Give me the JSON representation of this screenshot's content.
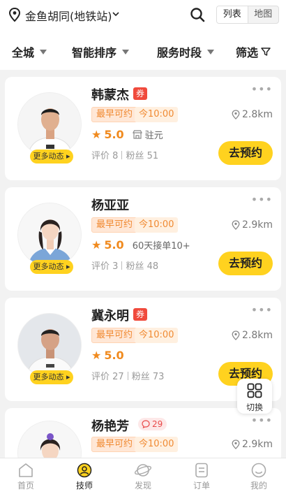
{
  "header": {
    "location": "金鱼胡同(地铁站)",
    "view_list": "列表",
    "view_map": "地图"
  },
  "filters": [
    "全城",
    "智能排序",
    "服务时段",
    "筛选"
  ],
  "technicians": [
    {
      "name": "韩蒙杰",
      "badge": "券",
      "tag_label": "最早可约",
      "tag_time": "今10:00",
      "distance": "2.8km",
      "rating": "5.0",
      "extra": "驻元",
      "reviews_label": "评价",
      "reviews": "8",
      "fans_label": "粉丝",
      "fans": "51",
      "more": "更多动态",
      "book": "去预约"
    },
    {
      "name": "杨亚亚",
      "badge": "",
      "tag_label": "最早可约",
      "tag_time": "今10:00",
      "distance": "2.9km",
      "rating": "5.0",
      "extra": "60天接单10+",
      "reviews_label": "评价",
      "reviews": "3",
      "fans_label": "粉丝",
      "fans": "48",
      "more": "更多动态",
      "book": "去预约"
    },
    {
      "name": "冀永明",
      "badge": "券",
      "tag_label": "最早可约",
      "tag_time": "今10:00",
      "distance": "2.8km",
      "rating": "5.0",
      "extra": "",
      "reviews_label": "评价",
      "reviews": "27",
      "fans_label": "粉丝",
      "fans": "73",
      "more": "更多动态",
      "book": "去预约"
    },
    {
      "name": "杨艳芳",
      "badge": "29",
      "tag_label": "最早可约",
      "tag_time": "今10:00",
      "distance": "2.9km",
      "rating": "",
      "extra": "",
      "reviews_label": "",
      "reviews": "",
      "fans_label": "",
      "fans": "",
      "more": "",
      "book": ""
    }
  ],
  "switch_label": "切换",
  "bottom_nav": [
    {
      "label": "首页",
      "icon": "home-icon"
    },
    {
      "label": "技师",
      "icon": "technician-icon",
      "active": true
    },
    {
      "label": "发现",
      "icon": "discover-icon"
    },
    {
      "label": "订单",
      "icon": "order-icon"
    },
    {
      "label": "我的",
      "icon": "profile-icon"
    }
  ],
  "colors": {
    "accent": "#ffd21f",
    "orange": "#f08a1e",
    "coupon_red": "#f04a3c"
  }
}
